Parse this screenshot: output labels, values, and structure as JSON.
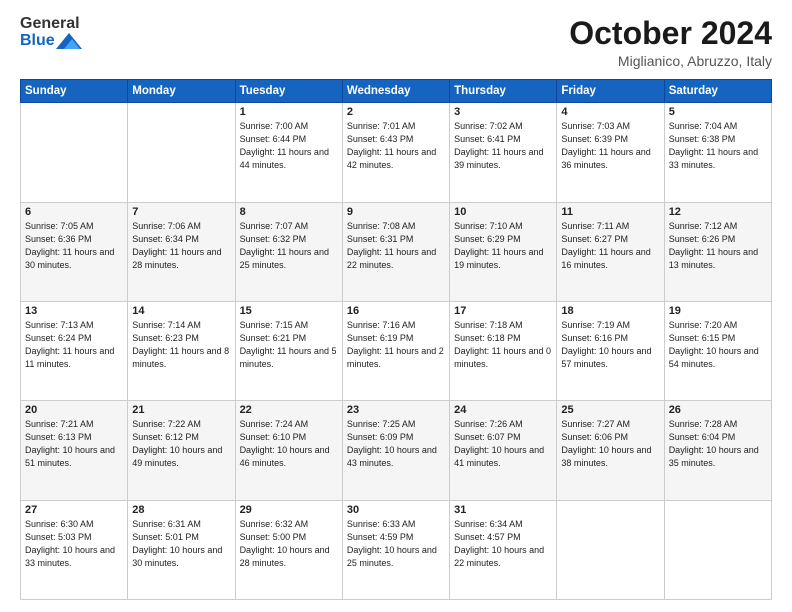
{
  "header": {
    "logo_general": "General",
    "logo_blue": "Blue",
    "title": "October 2024",
    "location": "Miglianico, Abruzzo, Italy"
  },
  "weekdays": [
    "Sunday",
    "Monday",
    "Tuesday",
    "Wednesday",
    "Thursday",
    "Friday",
    "Saturday"
  ],
  "weeks": [
    [
      null,
      null,
      {
        "day": 1,
        "sunrise": "7:00 AM",
        "sunset": "6:44 PM",
        "daylight": "11 hours and 44 minutes."
      },
      {
        "day": 2,
        "sunrise": "7:01 AM",
        "sunset": "6:43 PM",
        "daylight": "11 hours and 42 minutes."
      },
      {
        "day": 3,
        "sunrise": "7:02 AM",
        "sunset": "6:41 PM",
        "daylight": "11 hours and 39 minutes."
      },
      {
        "day": 4,
        "sunrise": "7:03 AM",
        "sunset": "6:39 PM",
        "daylight": "11 hours and 36 minutes."
      },
      {
        "day": 5,
        "sunrise": "7:04 AM",
        "sunset": "6:38 PM",
        "daylight": "11 hours and 33 minutes."
      }
    ],
    [
      {
        "day": 6,
        "sunrise": "7:05 AM",
        "sunset": "6:36 PM",
        "daylight": "11 hours and 30 minutes."
      },
      {
        "day": 7,
        "sunrise": "7:06 AM",
        "sunset": "6:34 PM",
        "daylight": "11 hours and 28 minutes."
      },
      {
        "day": 8,
        "sunrise": "7:07 AM",
        "sunset": "6:32 PM",
        "daylight": "11 hours and 25 minutes."
      },
      {
        "day": 9,
        "sunrise": "7:08 AM",
        "sunset": "6:31 PM",
        "daylight": "11 hours and 22 minutes."
      },
      {
        "day": 10,
        "sunrise": "7:10 AM",
        "sunset": "6:29 PM",
        "daylight": "11 hours and 19 minutes."
      },
      {
        "day": 11,
        "sunrise": "7:11 AM",
        "sunset": "6:27 PM",
        "daylight": "11 hours and 16 minutes."
      },
      {
        "day": 12,
        "sunrise": "7:12 AM",
        "sunset": "6:26 PM",
        "daylight": "11 hours and 13 minutes."
      }
    ],
    [
      {
        "day": 13,
        "sunrise": "7:13 AM",
        "sunset": "6:24 PM",
        "daylight": "11 hours and 11 minutes."
      },
      {
        "day": 14,
        "sunrise": "7:14 AM",
        "sunset": "6:23 PM",
        "daylight": "11 hours and 8 minutes."
      },
      {
        "day": 15,
        "sunrise": "7:15 AM",
        "sunset": "6:21 PM",
        "daylight": "11 hours and 5 minutes."
      },
      {
        "day": 16,
        "sunrise": "7:16 AM",
        "sunset": "6:19 PM",
        "daylight": "11 hours and 2 minutes."
      },
      {
        "day": 17,
        "sunrise": "7:18 AM",
        "sunset": "6:18 PM",
        "daylight": "11 hours and 0 minutes."
      },
      {
        "day": 18,
        "sunrise": "7:19 AM",
        "sunset": "6:16 PM",
        "daylight": "10 hours and 57 minutes."
      },
      {
        "day": 19,
        "sunrise": "7:20 AM",
        "sunset": "6:15 PM",
        "daylight": "10 hours and 54 minutes."
      }
    ],
    [
      {
        "day": 20,
        "sunrise": "7:21 AM",
        "sunset": "6:13 PM",
        "daylight": "10 hours and 51 minutes."
      },
      {
        "day": 21,
        "sunrise": "7:22 AM",
        "sunset": "6:12 PM",
        "daylight": "10 hours and 49 minutes."
      },
      {
        "day": 22,
        "sunrise": "7:24 AM",
        "sunset": "6:10 PM",
        "daylight": "10 hours and 46 minutes."
      },
      {
        "day": 23,
        "sunrise": "7:25 AM",
        "sunset": "6:09 PM",
        "daylight": "10 hours and 43 minutes."
      },
      {
        "day": 24,
        "sunrise": "7:26 AM",
        "sunset": "6:07 PM",
        "daylight": "10 hours and 41 minutes."
      },
      {
        "day": 25,
        "sunrise": "7:27 AM",
        "sunset": "6:06 PM",
        "daylight": "10 hours and 38 minutes."
      },
      {
        "day": 26,
        "sunrise": "7:28 AM",
        "sunset": "6:04 PM",
        "daylight": "10 hours and 35 minutes."
      }
    ],
    [
      {
        "day": 27,
        "sunrise": "6:30 AM",
        "sunset": "5:03 PM",
        "daylight": "10 hours and 33 minutes."
      },
      {
        "day": 28,
        "sunrise": "6:31 AM",
        "sunset": "5:01 PM",
        "daylight": "10 hours and 30 minutes."
      },
      {
        "day": 29,
        "sunrise": "6:32 AM",
        "sunset": "5:00 PM",
        "daylight": "10 hours and 28 minutes."
      },
      {
        "day": 30,
        "sunrise": "6:33 AM",
        "sunset": "4:59 PM",
        "daylight": "10 hours and 25 minutes."
      },
      {
        "day": 31,
        "sunrise": "6:34 AM",
        "sunset": "4:57 PM",
        "daylight": "10 hours and 22 minutes."
      },
      null,
      null
    ]
  ]
}
